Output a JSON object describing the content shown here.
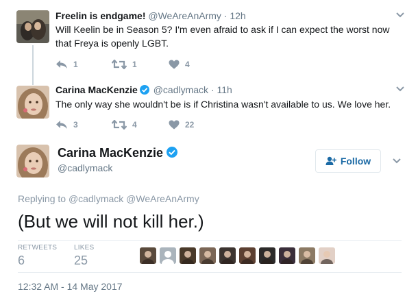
{
  "tweets": [
    {
      "name": "Freelin is endgame!",
      "handle": "@WeAreAnArmy",
      "dot": "·",
      "time": "12h",
      "text": "Will Keelin be in Season 5? I'm even afraid to ask if I can expect the worst now that Freya is openly LGBT.",
      "replies": "1",
      "retweets": "1",
      "likes": "4",
      "avatar_colors": [
        "#3b3a36",
        "#7a6a56",
        "#c9b9a3"
      ]
    },
    {
      "name": "Carina MacKenzie",
      "handle": "@cadlymack",
      "dot": "·",
      "time": "11h",
      "text": "The only way she wouldn't be is if Christina wasn't available to us. We love her.",
      "replies": "3",
      "retweets": "4",
      "likes": "22",
      "avatar_colors": [
        "#c5a98b",
        "#e8d6c4",
        "#8a6a4c"
      ]
    }
  ],
  "main_tweet": {
    "name": "Carina MacKenzie",
    "handle": "@cadlymack",
    "follow_label": "Follow",
    "replying_prefix": "Replying to",
    "replying_to": "@cadlymack @WeAreAnArmy",
    "text": "(But we will not kill her.)",
    "retweets_label": "RETWEETS",
    "retweets_count": "6",
    "likes_label": "LIKES",
    "likes_count": "25",
    "timestamp": "12:32 AM - 14 May 2017",
    "liker_avatar_colors": [
      "#5a4a3c",
      "#aab4bc",
      "#4a3a2a",
      "#7b6656",
      "#3c3430",
      "#5c4032",
      "#2c2a2a",
      "#3a2e3a",
      "#8c7a64",
      "#e2d0c6"
    ]
  },
  "colors": {
    "accent": "#1da1f2",
    "muted": "#657786",
    "icon": "#8a98a6"
  }
}
